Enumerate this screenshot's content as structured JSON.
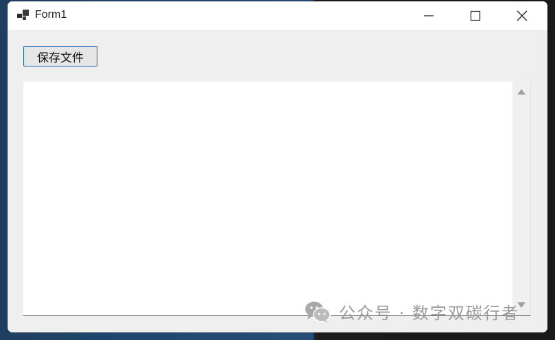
{
  "window": {
    "title": "Form1",
    "icons": {
      "app": "winforms-app-icon",
      "minimize": "minimize-icon",
      "maximize": "maximize-icon",
      "close": "close-icon"
    }
  },
  "toolbar": {
    "save_label": "保存文件"
  },
  "textbox": {
    "value": ""
  },
  "scrollbar": {
    "up": "scroll-up-arrow-icon",
    "down": "scroll-down-arrow-icon"
  },
  "watermark": {
    "text": "公众号 · 数字双碳行者",
    "icon": "wechat-icon"
  },
  "colors": {
    "accent_border": "#0a64bd",
    "titlebar": "#ffffff",
    "client": "#efefef"
  }
}
